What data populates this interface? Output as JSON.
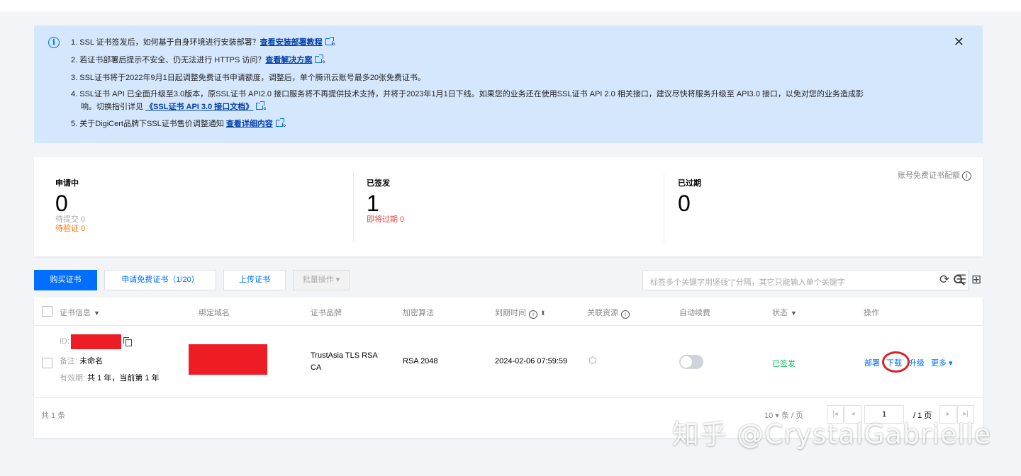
{
  "notice": {
    "items": [
      {
        "text": "1. SSL 证书签发后，如何基于自身环境进行安装部署？",
        "link": "查看安装部署教程",
        "tail": "。"
      },
      {
        "text": "2. 若证书部署后提示不安全、仍无法进行 HTTPS 访问？",
        "link": "查看解决方案",
        "tail": "。"
      },
      {
        "text": "3. SSL证书将于2022年9月1日起调整免费证书申请额度，调整后，单个腾讯云账号最多20张免费证书。",
        "link": "",
        "tail": ""
      },
      {
        "text": "4. SSL证书 API 已全面升级至3.0版本，原SSL证书 API2.0 接口服务将不再提供技术支持，并将于2023年1月1日下线。如果您的业务还在使用SSL证书 API 2.0 相关接口，建议尽快将服务升级至 API3.0 接口，以免对您的业务造成影",
        "text2": "响。切换指引详见 ",
        "link": "《SSL证书 API 3.0 接口文档》",
        "tail": "。"
      },
      {
        "text": "5. 关于DigiCert品牌下SSL证书售价调整通知 ",
        "link": "查看详细内容",
        "tail": "。"
      }
    ]
  },
  "stats": {
    "applying": {
      "label": "申请中",
      "value": "0",
      "sub1": "待提交 0",
      "sub2": "待验证 0"
    },
    "issued": {
      "label": "已签发",
      "value": "1",
      "sub1": "即将过期 0"
    },
    "expired": {
      "label": "已过期",
      "value": "0"
    },
    "quota_label": "账号免费证书配额"
  },
  "toolbar": {
    "buy": "购买证书",
    "apply_free": "申请免费证书（1/20）",
    "upload": "上传证书",
    "batch": "批量操作 ▾",
    "search_placeholder": "标签多个关键字用竖线\"|\"分隔，其它只能输入单个关键字"
  },
  "table": {
    "headers": [
      "证书信息",
      "绑定域名",
      "证书品牌",
      "加密算法",
      "到期时间",
      "关联资源",
      "自动续费",
      "状态",
      "操作"
    ],
    "row": {
      "id_label": "ID:",
      "remark_label": "备注:",
      "remark_value": "未命名",
      "validity_label": "有效期:",
      "validity_value": "共 1 年，当前第 1 年",
      "brand_line1": "TrustAsia TLS RSA",
      "brand_line2": "CA",
      "algo": "RSA 2048",
      "expire": "2024-02-06 07:59:59",
      "status": "已签发",
      "actions": {
        "deploy": "部署",
        "download": "下载",
        "upgrade": "升级",
        "more": "更多 ▾"
      }
    },
    "total": "共 1 条",
    "page_size": "10 ▾ 条 / 页",
    "page_input": "1",
    "page_total": "/ 1 页"
  },
  "colors": {
    "primary": "#006eff",
    "success": "#0abf5b",
    "danger": "#e54545",
    "warning": "#ff7200",
    "notice_bg": "#d5e7fd"
  },
  "watermark": "知乎 @CrystalGabrielle"
}
